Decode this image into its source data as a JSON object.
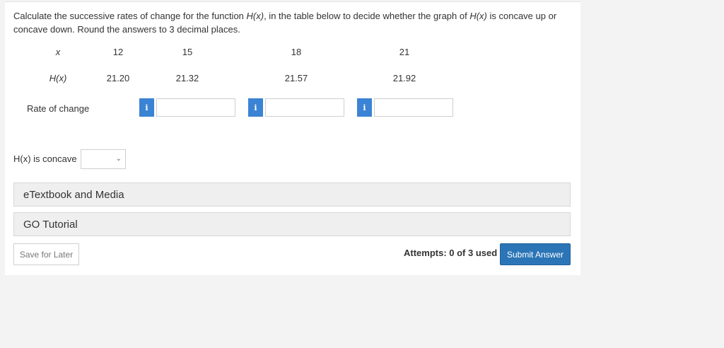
{
  "question": {
    "p1": "Calculate the successive rates of change for the function ",
    "fn1": "H(x)",
    "p2": ", in the table below to decide whether the graph of ",
    "fn2": "H(x)",
    "p3": " is concave up or concave down. Round the answers to 3 decimal places."
  },
  "table": {
    "x_label": "x",
    "h_label": "H(x)",
    "rate_label": "Rate of change",
    "x_values": [
      "12",
      "15",
      "18",
      "21"
    ],
    "h_values": [
      "21.20",
      "21.32",
      "21.57",
      "21.92"
    ],
    "rate_inputs": [
      "",
      "",
      ""
    ],
    "info_glyph": "i"
  },
  "concavity": {
    "label": "H(x) is concave",
    "selected": "",
    "chevron": "⌄"
  },
  "resources": {
    "etextbook": "eTextbook and Media",
    "go_tutorial": "GO Tutorial"
  },
  "footer": {
    "save_label": "Save for Later",
    "attempts": "Attempts: 0 of 3 used",
    "submit_label": "Submit Answer"
  },
  "colors": {
    "info_button": "#3b83d4",
    "submit_button": "#2b75b7"
  }
}
